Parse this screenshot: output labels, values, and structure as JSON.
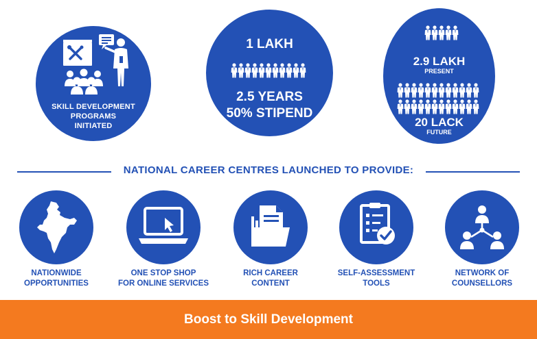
{
  "top": {
    "skill_programs": {
      "label_line1": "SKILL DEVELOPMENT",
      "label_line2": "PROGRAMS",
      "label_line3": "INITIATED"
    },
    "apprentice": {
      "count": "1 LAKH",
      "duration": "2.5 YEARS",
      "stipend": "50% STIPEND"
    },
    "capacity": {
      "present_value": "2.9 LAKH",
      "present_label": "PRESENT",
      "future_value": "20 LACK",
      "future_label": "FUTURE"
    }
  },
  "heading": "NATIONAL CAREER CENTRES LAUNCHED TO PROVIDE:",
  "features": [
    {
      "line1": "NATIONWIDE",
      "line2": "OPPORTUNITIES",
      "icon": "india-map-icon"
    },
    {
      "line1": "ONE STOP SHOP",
      "line2": "FOR ONLINE SERVICES",
      "icon": "laptop-cursor-icon"
    },
    {
      "line1": "RICH CAREER",
      "line2": "CONTENT",
      "icon": "folder-documents-icon"
    },
    {
      "line1": "SELF-ASSESSMENT",
      "line2": "TOOLS",
      "icon": "clipboard-check-icon"
    },
    {
      "line1": "NETWORK OF",
      "line2": "COUNSELLORS",
      "icon": "people-network-icon"
    }
  ],
  "footer": "Boost to Skill Development",
  "colors": {
    "primary_blue": "#2351b5",
    "footer_orange": "#f47a1f",
    "text_white": "#ffffff"
  }
}
